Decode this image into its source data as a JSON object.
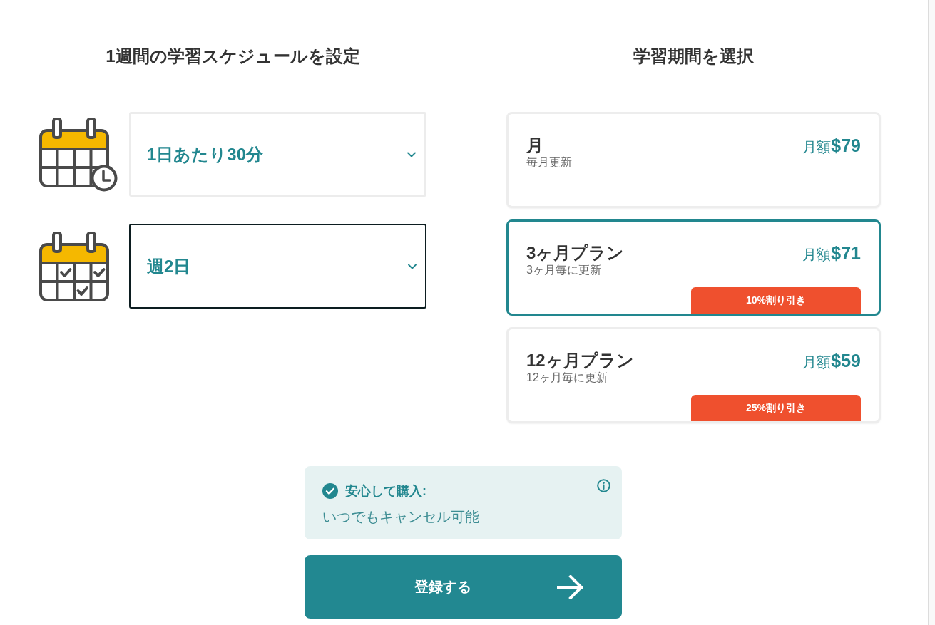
{
  "schedule": {
    "title": "1週間の学習スケジュールを設定",
    "selects": [
      {
        "kind": "time",
        "value": "1日あたり30分",
        "focused": false
      },
      {
        "kind": "days",
        "value": "週2日",
        "focused": true
      }
    ]
  },
  "plans": {
    "title": "学習期間を選択",
    "options": [
      {
        "name": "月",
        "renewal": "毎月更新",
        "price": "月額**$79**",
        "selected": false
      },
      {
        "name": "3ヶ月プラン",
        "renewal": "3ヶ月毎に更新",
        "price": "月額**$71**",
        "badge": "10%割り引き",
        "selected": true
      },
      {
        "name": "12ヶ月プラン",
        "renewal": "12ヶ月毎に更新",
        "price": "月額**$59**",
        "badge": "25%割り引き",
        "selected": false
      }
    ]
  },
  "guarantee": {
    "title": "安心して購入:",
    "text": "いつでもキャンセル可能"
  },
  "submit_button": {
    "label": "登録する"
  }
}
